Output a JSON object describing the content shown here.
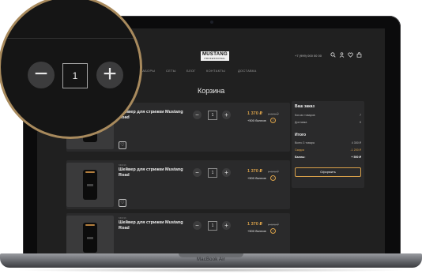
{
  "device": {
    "brand": "MacBook Air"
  },
  "header": {
    "logo": "MUSTANG",
    "logo_sub": "PROFESSIONAL",
    "phone": "+7 (999) 000 00 00",
    "icons": [
      "search-icon",
      "user-icon",
      "heart-icon",
      "bag-icon"
    ]
  },
  "nav": [
    "МУЖЧИНАМ",
    "НАБОРЫ",
    "СЕТЫ",
    "БЛОГ",
    "КОНТАКТЫ",
    "ДОСТАВКА"
  ],
  "page_title": "Корзина",
  "items": [
    {
      "code": "",
      "name": "Шейвер для стрижки Mustang Road",
      "qty": "1",
      "price": "1 370 ₽",
      "old_price": "2 370 ₽",
      "bonus": "+500 баллов"
    },
    {
      "code": "MR236",
      "name": "Шейвер для стрижки Mustang Road",
      "qty": "1",
      "price": "1 370 ₽",
      "old_price": "2 370 ₽",
      "bonus": "+500 баллов"
    },
    {
      "code": "MR236",
      "name": "Шейвер для стрижки Mustang Road",
      "qty": "1",
      "price": "1 370 ₽",
      "old_price": "2 370 ₽",
      "bonus": "+500 баллов"
    }
  ],
  "summary": {
    "heading": "Ваш заказ",
    "rows": [
      {
        "label": "Кол-во товаров",
        "value": "7"
      },
      {
        "label": "Доставка",
        "value": "0"
      }
    ],
    "total_heading": "Итого",
    "total_rows": [
      {
        "label": "Всего 3 товара",
        "value": "4 300 ₽"
      },
      {
        "label": "Скидка",
        "value": "-1 200 ₽"
      },
      {
        "label": "Баллы:",
        "value": "+ 500 ₽"
      }
    ],
    "checkout_label": "Оформить"
  },
  "magnifier": {
    "minus": "−",
    "value": "1",
    "plus": "+"
  },
  "colors": {
    "accent": "#d9a14a",
    "background": "#202020",
    "panel": "#2a2a2b",
    "ring": "#a88a5d"
  }
}
